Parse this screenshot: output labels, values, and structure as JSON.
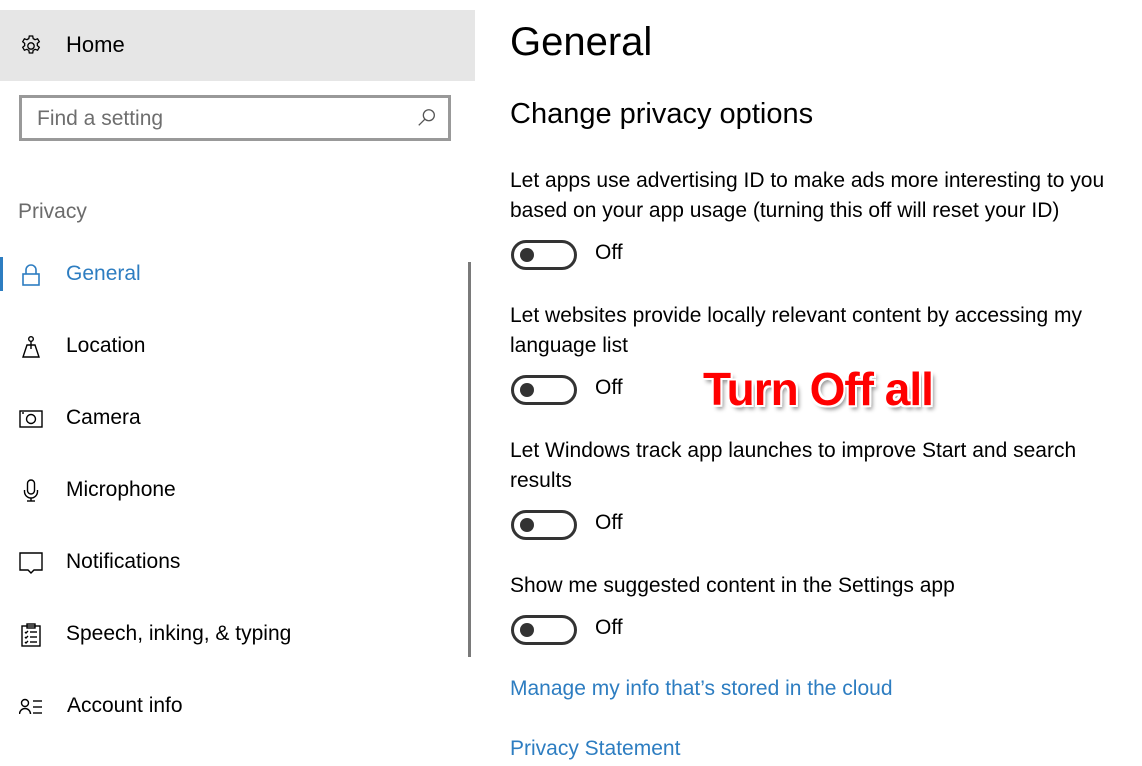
{
  "sidebar": {
    "home_label": "Home",
    "search": {
      "placeholder": "Find a setting",
      "value": ""
    },
    "section_label": "Privacy",
    "items": [
      {
        "label": "General",
        "icon": "lock-icon",
        "active": true
      },
      {
        "label": "Location",
        "icon": "location-icon",
        "active": false
      },
      {
        "label": "Camera",
        "icon": "camera-icon",
        "active": false
      },
      {
        "label": "Microphone",
        "icon": "microphone-icon",
        "active": false
      },
      {
        "label": "Notifications",
        "icon": "notifications-icon",
        "active": false
      },
      {
        "label": "Speech, inking, & typing",
        "icon": "clipboard-icon",
        "active": false
      },
      {
        "label": "Account info",
        "icon": "account-info-icon",
        "active": false
      }
    ]
  },
  "main": {
    "page_title": "General",
    "section_title": "Change privacy options",
    "options": [
      {
        "line1": "Let apps use advertising ID to make ads more interesting to you",
        "line2": "based on your app usage (turning this off will reset your ID)",
        "state": "Off"
      },
      {
        "line1": "Let websites provide locally relevant content by accessing my",
        "line2": "language list",
        "state": "Off"
      },
      {
        "line1": "Let Windows track app launches to improve Start and search",
        "line2": "results",
        "state": "Off"
      },
      {
        "line1": "Show me suggested content in the Settings app",
        "state": "Off"
      }
    ],
    "links": {
      "manage_cloud": "Manage my info that’s stored in the cloud",
      "privacy_statement": "Privacy Statement"
    }
  },
  "annotation": {
    "text": "Turn Off all",
    "color": "#ff0000"
  },
  "colors": {
    "accent": "#2d7dc1",
    "home_bg": "#e6e6e6"
  }
}
